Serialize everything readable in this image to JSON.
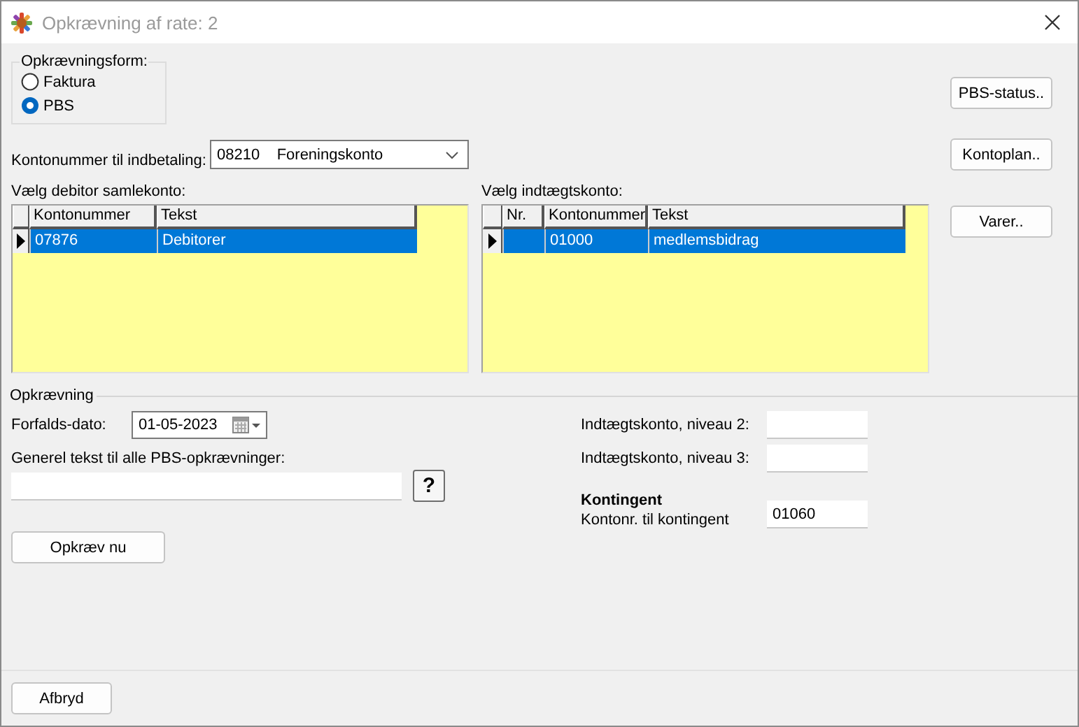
{
  "window": {
    "title": "Opkrævning af rate: 2"
  },
  "payment_form": {
    "legend": "Opkrævningsform:",
    "options": [
      {
        "label": "Faktura",
        "selected": false
      },
      {
        "label": "PBS",
        "selected": true
      }
    ]
  },
  "side_buttons": [
    "PBS-status..",
    "Kontoplan..",
    "Varer.."
  ],
  "deposit_account": {
    "label": "Kontonummer til indbetaling:",
    "value": "08210    Foreningskonto"
  },
  "debtor_table": {
    "label": "Vælg debitor samlekonto:",
    "columns": [
      "Kontonummer",
      "Tekst"
    ],
    "rows": [
      {
        "cells": [
          "07876",
          "Debitorer"
        ],
        "selected": true
      }
    ]
  },
  "income_table": {
    "label": "Vælg indtægtskonto:",
    "columns": [
      "Nr.",
      "Kontonummer",
      "Tekst"
    ],
    "rows": [
      {
        "cells": [
          null,
          "01000",
          "medlemsbidrag"
        ],
        "selected": true
      }
    ]
  },
  "collection": {
    "heading": "Opkrævning",
    "due_date": {
      "label": "Forfalds-dato:",
      "value": "01-05-2023"
    },
    "general_text": {
      "label": "Generel tekst til alle PBS-opkrævninger:"
    },
    "help_button": "?",
    "collect_button": "Opkræv nu"
  },
  "income_levels": [
    {
      "label": "Indtægtskonto, niveau 2:"
    },
    {
      "label": "Indtægtskonto, niveau 3:"
    }
  ],
  "membership": {
    "heading": "Kontingent",
    "label": "Kontonr. til kontingent",
    "value": "01060"
  },
  "cancel_button": "Afbryd"
}
